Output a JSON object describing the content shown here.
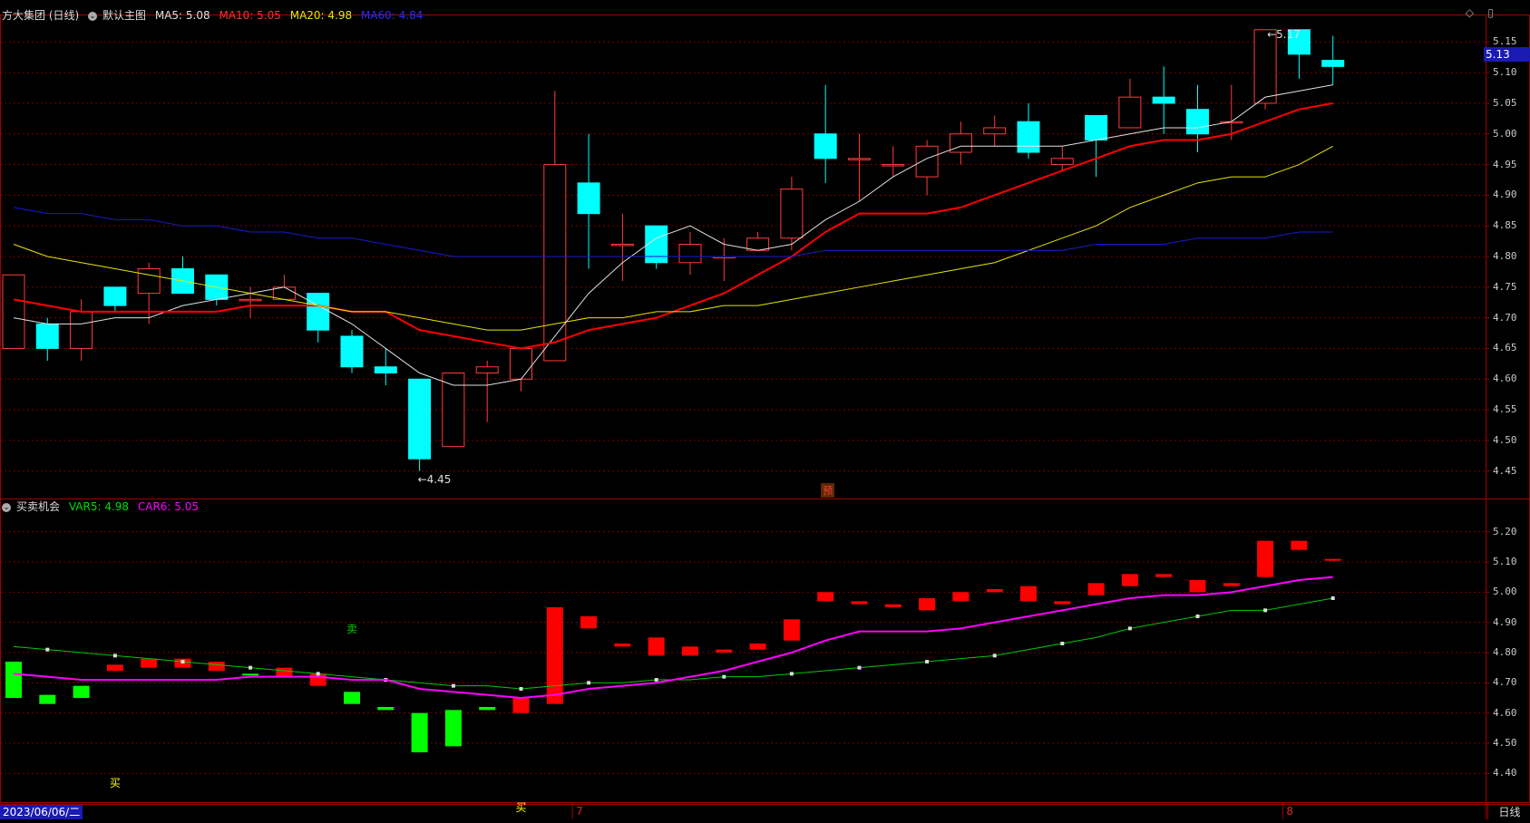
{
  "main_header": {
    "stock": "方大集团 (日线)",
    "template": "默认主图",
    "ma5": "MA5: 5.08",
    "ma10": "MA10: 5.05",
    "ma20": "MA20: 4.98",
    "ma60": "MA60: 4.84"
  },
  "sub_header": {
    "name": "买卖机会",
    "var5": "VAR5: 4.98",
    "car6": "CAR6: 5.05"
  },
  "current_price": "5.13",
  "date_label": "2023/06/06/二",
  "period_label": "日线",
  "month_labels": [
    "7",
    "8"
  ],
  "annotations": {
    "low": "4.45",
    "high": "5.17",
    "pre_marker": "预"
  },
  "signals": [
    {
      "text": "买",
      "index": 3,
      "panel": "sub",
      "value": 4.37,
      "color": "#ffff00"
    },
    {
      "text": "卖",
      "index": 10,
      "panel": "sub",
      "value": 4.88,
      "color": "#00c800"
    },
    {
      "text": "买",
      "index": 15,
      "panel": "sub",
      "value": 4.29,
      "color": "#ffff00"
    }
  ],
  "colors": {
    "up": "#ff3b3b",
    "down": "#00ffff",
    "ma5": "#e0e0e0",
    "ma10": "#ff0000",
    "ma20": "#e6e600",
    "ma60": "#1a1ad2",
    "sub_up": "#ff0000",
    "sub_down": "#00ff00",
    "var5": "#00c800",
    "car6": "#ff00ff",
    "grid": "#7a0000",
    "border": "#a00000"
  },
  "chart_data": [
    {
      "type": "candlestick",
      "title": "方大集团 (日线)",
      "ylim": [
        4.42,
        5.18
      ],
      "yticks": [
        "4.45",
        "4.50",
        "4.55",
        "4.60",
        "4.65",
        "4.70",
        "4.75",
        "4.80",
        "4.85",
        "4.90",
        "4.95",
        "5.00",
        "5.05",
        "5.10",
        "5.15"
      ],
      "candles": [
        {
          "o": 4.65,
          "h": 4.77,
          "l": 4.65,
          "c": 4.77
        },
        {
          "o": 4.69,
          "h": 4.7,
          "l": 4.63,
          "c": 4.65
        },
        {
          "o": 4.65,
          "h": 4.73,
          "l": 4.63,
          "c": 4.71
        },
        {
          "o": 4.75,
          "h": 4.75,
          "l": 4.71,
          "c": 4.72
        },
        {
          "o": 4.74,
          "h": 4.79,
          "l": 4.69,
          "c": 4.78
        },
        {
          "o": 4.78,
          "h": 4.8,
          "l": 4.74,
          "c": 4.74
        },
        {
          "o": 4.77,
          "h": 4.77,
          "l": 4.72,
          "c": 4.73
        },
        {
          "o": 4.73,
          "h": 4.75,
          "l": 4.7,
          "c": 4.73
        },
        {
          "o": 4.73,
          "h": 4.77,
          "l": 4.73,
          "c": 4.75
        },
        {
          "o": 4.74,
          "h": 4.74,
          "l": 4.66,
          "c": 4.68
        },
        {
          "o": 4.67,
          "h": 4.68,
          "l": 4.61,
          "c": 4.62
        },
        {
          "o": 4.62,
          "h": 4.65,
          "l": 4.59,
          "c": 4.61
        },
        {
          "o": 4.6,
          "h": 4.6,
          "l": 4.45,
          "c": 4.47
        },
        {
          "o": 4.49,
          "h": 4.61,
          "l": 4.49,
          "c": 4.61
        },
        {
          "o": 4.61,
          "h": 4.63,
          "l": 4.53,
          "c": 4.62
        },
        {
          "o": 4.6,
          "h": 4.65,
          "l": 4.58,
          "c": 4.65
        },
        {
          "o": 4.63,
          "h": 5.07,
          "l": 4.63,
          "c": 4.95
        },
        {
          "o": 4.92,
          "h": 5.0,
          "l": 4.78,
          "c": 4.87
        },
        {
          "o": 4.82,
          "h": 4.87,
          "l": 4.76,
          "c": 4.82
        },
        {
          "o": 4.85,
          "h": 4.85,
          "l": 4.78,
          "c": 4.79
        },
        {
          "o": 4.79,
          "h": 4.84,
          "l": 4.77,
          "c": 4.82
        },
        {
          "o": 4.8,
          "h": 4.83,
          "l": 4.76,
          "c": 4.8
        },
        {
          "o": 4.81,
          "h": 4.84,
          "l": 4.81,
          "c": 4.83
        },
        {
          "o": 4.83,
          "h": 4.93,
          "l": 4.81,
          "c": 4.91
        },
        {
          "o": 5.0,
          "h": 5.08,
          "l": 4.92,
          "c": 4.96
        },
        {
          "o": 4.96,
          "h": 5.0,
          "l": 4.89,
          "c": 4.96
        },
        {
          "o": 4.95,
          "h": 4.98,
          "l": 4.93,
          "c": 4.95
        },
        {
          "o": 4.93,
          "h": 4.99,
          "l": 4.9,
          "c": 4.98
        },
        {
          "o": 4.97,
          "h": 5.02,
          "l": 4.95,
          "c": 5.0
        },
        {
          "o": 5.0,
          "h": 5.03,
          "l": 4.98,
          "c": 5.01
        },
        {
          "o": 5.02,
          "h": 5.05,
          "l": 4.96,
          "c": 4.97
        },
        {
          "o": 4.95,
          "h": 4.98,
          "l": 4.94,
          "c": 4.96
        },
        {
          "o": 5.03,
          "h": 5.03,
          "l": 4.93,
          "c": 4.99
        },
        {
          "o": 5.01,
          "h": 5.09,
          "l": 5.01,
          "c": 5.06
        },
        {
          "o": 5.06,
          "h": 5.11,
          "l": 5.0,
          "c": 5.05
        },
        {
          "o": 5.04,
          "h": 5.08,
          "l": 4.97,
          "c": 5.0
        },
        {
          "o": 5.02,
          "h": 5.08,
          "l": 4.99,
          "c": 5.02
        },
        {
          "o": 5.05,
          "h": 5.17,
          "l": 5.04,
          "c": 5.17
        },
        {
          "o": 5.17,
          "h": 5.17,
          "l": 5.09,
          "c": 5.13
        },
        {
          "o": 5.12,
          "h": 5.16,
          "l": 5.08,
          "c": 5.11
        }
      ],
      "series": [
        {
          "name": "MA5",
          "values": [
            4.7,
            4.69,
            4.69,
            4.7,
            4.7,
            4.72,
            4.73,
            4.74,
            4.75,
            4.72,
            4.69,
            4.65,
            4.61,
            4.59,
            4.59,
            4.6,
            4.67,
            4.74,
            4.79,
            4.83,
            4.85,
            4.82,
            4.81,
            4.82,
            4.86,
            4.89,
            4.93,
            4.96,
            4.98,
            4.98,
            4.98,
            4.98,
            4.99,
            5.0,
            5.01,
            5.01,
            5.02,
            5.06,
            5.07,
            5.08
          ]
        },
        {
          "name": "MA10",
          "values": [
            4.73,
            4.72,
            4.71,
            4.71,
            4.71,
            4.71,
            4.71,
            4.72,
            4.72,
            4.72,
            4.71,
            4.71,
            4.68,
            4.67,
            4.66,
            4.65,
            4.66,
            4.68,
            4.69,
            4.7,
            4.72,
            4.74,
            4.77,
            4.8,
            4.84,
            4.87,
            4.87,
            4.87,
            4.88,
            4.9,
            4.92,
            4.94,
            4.96,
            4.98,
            4.99,
            4.99,
            5.0,
            5.02,
            5.04,
            5.05
          ]
        },
        {
          "name": "MA20",
          "values": [
            4.82,
            4.8,
            4.79,
            4.78,
            4.77,
            4.76,
            4.75,
            4.74,
            4.73,
            4.72,
            4.71,
            4.71,
            4.7,
            4.69,
            4.68,
            4.68,
            4.69,
            4.7,
            4.7,
            4.71,
            4.71,
            4.72,
            4.72,
            4.73,
            4.74,
            4.75,
            4.76,
            4.77,
            4.78,
            4.79,
            4.81,
            4.83,
            4.85,
            4.88,
            4.9,
            4.92,
            4.93,
            4.93,
            4.95,
            4.98
          ]
        },
        {
          "name": "MA60",
          "values": [
            4.88,
            4.87,
            4.87,
            4.86,
            4.86,
            4.85,
            4.85,
            4.84,
            4.84,
            4.83,
            4.83,
            4.82,
            4.81,
            4.8,
            4.8,
            4.8,
            4.8,
            4.8,
            4.8,
            4.8,
            4.8,
            4.8,
            4.8,
            4.8,
            4.81,
            4.81,
            4.81,
            4.81,
            4.81,
            4.81,
            4.81,
            4.81,
            4.82,
            4.82,
            4.82,
            4.83,
            4.83,
            4.83,
            4.84,
            4.84
          ]
        }
      ]
    },
    {
      "type": "bar",
      "title": "买卖机会",
      "ylim": [
        4.32,
        5.25
      ],
      "yticks": [
        "4.40",
        "4.50",
        "4.60",
        "4.70",
        "4.80",
        "4.90",
        "5.00",
        "5.10",
        "5.20"
      ],
      "bars": [
        {
          "a": 4.65,
          "b": 4.77,
          "up": false
        },
        {
          "a": 4.63,
          "b": 4.66,
          "up": false
        },
        {
          "a": 4.65,
          "b": 4.69,
          "up": false
        },
        {
          "a": 4.74,
          "b": 4.76,
          "up": true
        },
        {
          "a": 4.75,
          "b": 4.78,
          "up": true
        },
        {
          "a": 4.75,
          "b": 4.78,
          "up": true
        },
        {
          "a": 4.74,
          "b": 4.77,
          "up": true
        },
        {
          "a": 4.73,
          "b": 4.73,
          "up": false
        },
        {
          "a": 4.72,
          "b": 4.75,
          "up": true
        },
        {
          "a": 4.69,
          "b": 4.73,
          "up": true
        },
        {
          "a": 4.63,
          "b": 4.67,
          "up": false
        },
        {
          "a": 4.61,
          "b": 4.62,
          "up": false
        },
        {
          "a": 4.47,
          "b": 4.6,
          "up": false
        },
        {
          "a": 4.49,
          "b": 4.61,
          "up": false
        },
        {
          "a": 4.61,
          "b": 4.62,
          "up": false
        },
        {
          "a": 4.6,
          "b": 4.65,
          "up": true
        },
        {
          "a": 4.63,
          "b": 4.95,
          "up": true
        },
        {
          "a": 4.88,
          "b": 4.92,
          "up": true
        },
        {
          "a": 4.82,
          "b": 4.83,
          "up": true
        },
        {
          "a": 4.79,
          "b": 4.85,
          "up": true
        },
        {
          "a": 4.79,
          "b": 4.82,
          "up": true
        },
        {
          "a": 4.8,
          "b": 4.81,
          "up": true
        },
        {
          "a": 4.81,
          "b": 4.83,
          "up": true
        },
        {
          "a": 4.84,
          "b": 4.91,
          "up": true
        },
        {
          "a": 4.97,
          "b": 5.0,
          "up": true
        },
        {
          "a": 4.96,
          "b": 4.97,
          "up": true
        },
        {
          "a": 4.95,
          "b": 4.96,
          "up": true
        },
        {
          "a": 4.94,
          "b": 4.98,
          "up": true
        },
        {
          "a": 4.97,
          "b": 5.0,
          "up": true
        },
        {
          "a": 5.0,
          "b": 5.01,
          "up": true
        },
        {
          "a": 4.97,
          "b": 5.02,
          "up": true
        },
        {
          "a": 4.96,
          "b": 4.97,
          "up": true
        },
        {
          "a": 4.99,
          "b": 5.03,
          "up": true
        },
        {
          "a": 5.02,
          "b": 5.06,
          "up": true
        },
        {
          "a": 5.05,
          "b": 5.06,
          "up": true
        },
        {
          "a": 5.0,
          "b": 5.04,
          "up": true
        },
        {
          "a": 5.02,
          "b": 5.03,
          "up": true
        },
        {
          "a": 5.05,
          "b": 5.17,
          "up": true
        },
        {
          "a": 5.14,
          "b": 5.17,
          "up": true
        },
        {
          "a": 5.11,
          "b": 5.11,
          "up": true
        }
      ],
      "series": [
        {
          "name": "VAR5",
          "values": [
            4.82,
            4.81,
            4.8,
            4.79,
            4.78,
            4.77,
            4.76,
            4.75,
            4.74,
            4.73,
            4.72,
            4.71,
            4.7,
            4.69,
            4.69,
            4.68,
            4.69,
            4.7,
            4.7,
            4.71,
            4.71,
            4.72,
            4.72,
            4.73,
            4.74,
            4.75,
            4.76,
            4.77,
            4.78,
            4.79,
            4.81,
            4.83,
            4.85,
            4.88,
            4.9,
            4.92,
            4.94,
            4.94,
            4.96,
            4.98
          ]
        },
        {
          "name": "CAR6",
          "values": [
            4.73,
            4.72,
            4.71,
            4.71,
            4.71,
            4.71,
            4.71,
            4.72,
            4.72,
            4.72,
            4.71,
            4.71,
            4.68,
            4.67,
            4.66,
            4.65,
            4.66,
            4.68,
            4.69,
            4.7,
            4.72,
            4.74,
            4.77,
            4.8,
            4.84,
            4.87,
            4.87,
            4.87,
            4.88,
            4.9,
            4.92,
            4.94,
            4.96,
            4.98,
            4.99,
            4.99,
            5.0,
            5.02,
            5.04,
            5.05
          ]
        }
      ]
    }
  ]
}
